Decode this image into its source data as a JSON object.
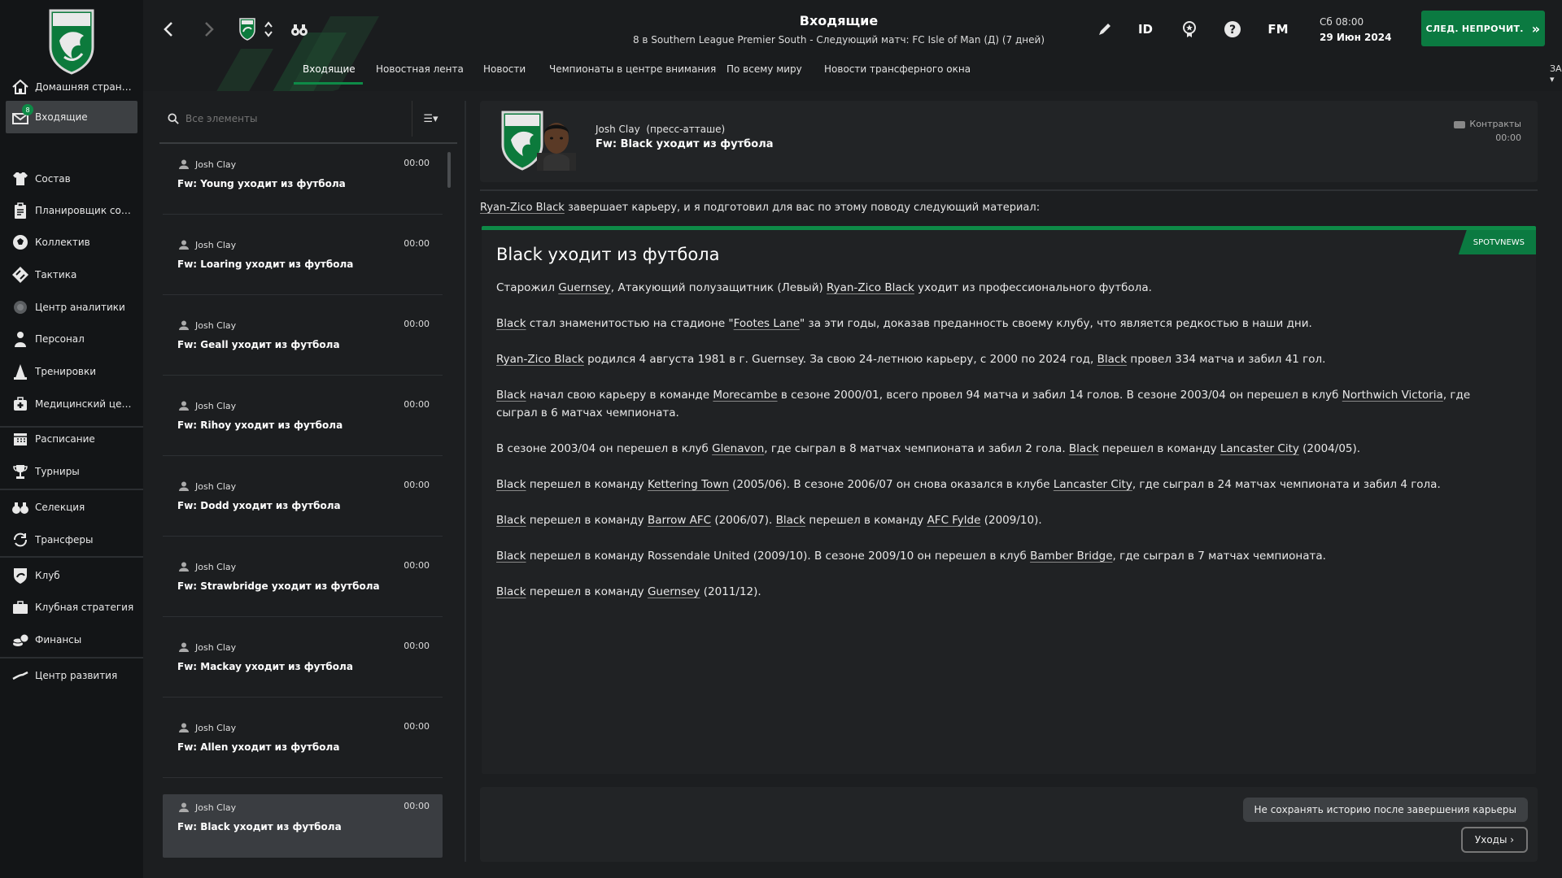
{
  "sidebar": {
    "inbox_badge": "8",
    "items": [
      {
        "label": "Домашняя страница",
        "icon": "home-icon"
      },
      {
        "label": "Входящие",
        "icon": "inbox-icon"
      },
      {
        "label": "Состав",
        "icon": "shirt-icon"
      },
      {
        "label": "Планировщик сост...",
        "icon": "clipboard-icon"
      },
      {
        "label": "Коллектив",
        "icon": "team-icon"
      },
      {
        "label": "Тактика",
        "icon": "tactics-icon"
      },
      {
        "label": "Центр аналитики",
        "icon": "analytics-icon"
      },
      {
        "label": "Персонал",
        "icon": "staff-icon"
      },
      {
        "label": "Тренировки",
        "icon": "training-cone-icon"
      },
      {
        "label": "Медицинский центр",
        "icon": "medical-icon"
      },
      {
        "label": "Расписание",
        "icon": "calendar-icon"
      },
      {
        "label": "Турниры",
        "icon": "trophy-icon"
      },
      {
        "label": "Селекция",
        "icon": "binoculars-icon"
      },
      {
        "label": "Трансферы",
        "icon": "transfer-icon"
      },
      {
        "label": "Клуб",
        "icon": "club-shield-icon"
      },
      {
        "label": "Клубная стратегия",
        "icon": "briefcase-icon"
      },
      {
        "label": "Финансы",
        "icon": "finance-icon"
      },
      {
        "label": "Центр развития",
        "icon": "development-icon"
      }
    ]
  },
  "header": {
    "title": "Входящие",
    "subtitle": "8 в Southern League Premier South - Следующий матч: FC Isle of Man (Д) (7 дней)",
    "id_label": "ID",
    "fm_label": "FM",
    "time": "Сб 08:00",
    "date": "29 Июн 2024",
    "continue_label": "СЛЕД. НЕПРОЧИТ.",
    "bookmarks_label": "ЗАКЛАДКИ",
    "tabs": [
      {
        "label": "Входящие"
      },
      {
        "label": "Новостная лента"
      },
      {
        "label": "Новости"
      },
      {
        "label": "Чемпионаты в центре внимания"
      },
      {
        "label": "По всему миру"
      },
      {
        "label": "Новости трансферного окна"
      }
    ]
  },
  "inbox": {
    "search_placeholder": "Все элементы",
    "messages": [
      {
        "sender": "Josh Clay",
        "time": "00:00",
        "subject": "Fw: Young уходит из футбола"
      },
      {
        "sender": "Josh Clay",
        "time": "00:00",
        "subject": "Fw: Loaring уходит из футбола"
      },
      {
        "sender": "Josh Clay",
        "time": "00:00",
        "subject": "Fw: Geall уходит из футбола"
      },
      {
        "sender": "Josh Clay",
        "time": "00:00",
        "subject": "Fw: Rihoy уходит из футбола"
      },
      {
        "sender": "Josh Clay",
        "time": "00:00",
        "subject": "Fw: Dodd уходит из футбола"
      },
      {
        "sender": "Josh Clay",
        "time": "00:00",
        "subject": "Fw: Strawbridge уходит из футбола"
      },
      {
        "sender": "Josh Clay",
        "time": "00:00",
        "subject": "Fw: Mackay уходит из футбола"
      },
      {
        "sender": "Josh Clay",
        "time": "00:00",
        "subject": "Fw: Allen уходит из футбола"
      },
      {
        "sender": "Josh Clay",
        "time": "00:00",
        "subject": "Fw: Black уходит из футбола"
      }
    ]
  },
  "message": {
    "from_name": "Josh Clay",
    "from_role": "(пресс-атташе)",
    "subject": "Fw: Black уходит из футбола",
    "category": "Контракты",
    "time": "00:00",
    "intro_link": "Ryan-Zico Black",
    "intro_rest": " завершает карьеру, и я подготовил для вас по этому поводу следующий материал:",
    "badge": "SPOTVNEWS",
    "article_title": "Black уходит из футбола",
    "paragraphs": [
      [
        {
          "t": "Старожил "
        },
        {
          "t": "Guernsey",
          "u": true
        },
        {
          "t": ", Атакующий полузащитник (Левый) "
        },
        {
          "t": "Ryan-Zico Black",
          "u": true
        },
        {
          "t": " уходит из профессионального футбола."
        }
      ],
      [
        {
          "t": "Black",
          "u": true
        },
        {
          "t": " стал знаменитостью на стадионе \""
        },
        {
          "t": "Footes Lane",
          "u": true
        },
        {
          "t": "\" за эти годы, доказав преданность своему клубу, что является редкостью в наши дни."
        }
      ],
      [
        {
          "t": "Ryan-Zico Black",
          "u": true
        },
        {
          "t": " родился 4 августа 1981 в г. Guernsey. За свою 24-летнюю карьеру, с 2000 по 2024 год, "
        },
        {
          "t": "Black",
          "u": true
        },
        {
          "t": " провел 334 матча и забил 41 гол."
        }
      ],
      [
        {
          "t": "Black",
          "u": true
        },
        {
          "t": " начал свою карьеру в команде "
        },
        {
          "t": "Morecambe",
          "u": true
        },
        {
          "t": " в сезоне 2000/01, всего провел 94 матча и забил 14 голов. В сезоне 2003/04 он перешел в клуб "
        },
        {
          "t": "Northwich Victoria",
          "u": true
        },
        {
          "t": ", где сыграл в 6 матчах чемпионата."
        }
      ],
      [
        {
          "t": "В сезоне 2003/04 он перешел в клуб "
        },
        {
          "t": "Glenavon",
          "u": true
        },
        {
          "t": ", где сыграл в 8 матчах чемпионата и забил 2 гола. "
        },
        {
          "t": "Black",
          "u": true
        },
        {
          "t": " перешел в команду "
        },
        {
          "t": "Lancaster City",
          "u": true
        },
        {
          "t": " (2004/05)."
        }
      ],
      [
        {
          "t": "Black",
          "u": true
        },
        {
          "t": " перешел в команду "
        },
        {
          "t": "Kettering Town",
          "u": true
        },
        {
          "t": " (2005/06). В сезоне 2006/07 он снова оказался в клубе "
        },
        {
          "t": "Lancaster City",
          "u": true
        },
        {
          "t": ", где сыграл в 24 матчах чемпионата и забил 4 гола."
        }
      ],
      [
        {
          "t": "Black",
          "u": true
        },
        {
          "t": " перешел в команду "
        },
        {
          "t": "Barrow AFC",
          "u": true
        },
        {
          "t": " (2006/07). "
        },
        {
          "t": "Black",
          "u": true
        },
        {
          "t": " перешел в команду "
        },
        {
          "t": "AFC Fylde",
          "u": true
        },
        {
          "t": " (2009/10)."
        }
      ],
      [
        {
          "t": "Black",
          "u": true
        },
        {
          "t": " перешел в команду Rossendale United (2009/10). В сезоне 2009/10 он перешел в клуб "
        },
        {
          "t": "Bamber Bridge",
          "u": true
        },
        {
          "t": ", где сыграл в 7 матчах чемпионата."
        }
      ],
      [
        {
          "t": "Black",
          "u": true
        },
        {
          "t": " перешел в команду "
        },
        {
          "t": "Guernsey",
          "u": true
        },
        {
          "t": " (2011/12)."
        }
      ]
    ],
    "option_label": "Не сохранять историю после завершения карьеры",
    "action_label": "Уходы"
  },
  "colors": {
    "accent": "#0e8a47",
    "accent_dark": "#0b7a41",
    "sidebar_bg": "#131517",
    "panel_bg": "#222426"
  }
}
